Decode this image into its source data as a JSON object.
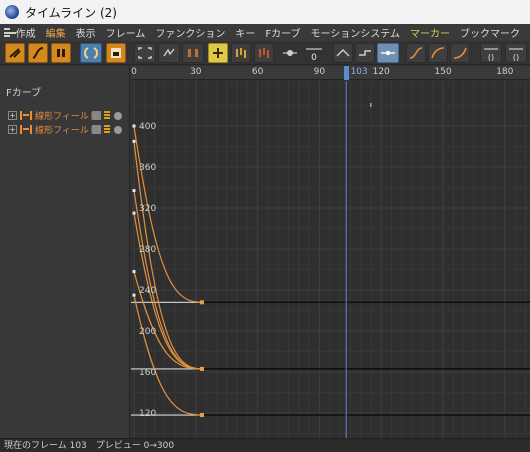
{
  "window": {
    "title": "タイムライン (2)"
  },
  "menu": {
    "items": [
      {
        "label": "作成"
      },
      {
        "label": "編集",
        "active": true
      },
      {
        "label": "表示"
      },
      {
        "label": "フレーム"
      },
      {
        "label": "ファンクション"
      },
      {
        "label": "キー"
      },
      {
        "label": "Fカーブ"
      },
      {
        "label": "モーションシステム"
      },
      {
        "label": "マーカー",
        "marker": true
      },
      {
        "label": "ブックマーク"
      }
    ]
  },
  "panel": {
    "fcurve_label": "Fカーブ",
    "tracks": [
      {
        "expand": "+",
        "label": "線形フィールド"
      },
      {
        "expand": "+",
        "label": "線形フィールド"
      }
    ]
  },
  "ruler": {
    "ticks": [
      "0",
      "30",
      "60",
      "90",
      "120",
      "150",
      "180"
    ],
    "current_frame": "103"
  },
  "chart_data": {
    "type": "line",
    "x_axis": {
      "ticks": [
        0,
        30,
        60,
        90,
        120,
        150,
        180
      ],
      "current_frame": 103
    },
    "y_axis": {
      "ticks": [
        400,
        360,
        320,
        280,
        240,
        200,
        160,
        120
      ]
    },
    "series": [
      {
        "values": [
          [
            0,
            400
          ],
          [
            33,
            228
          ]
        ]
      },
      {
        "values": [
          [
            0,
            385
          ],
          [
            33,
            163
          ]
        ]
      },
      {
        "values": [
          [
            0,
            337
          ],
          [
            33,
            163
          ]
        ]
      },
      {
        "values": [
          [
            0,
            315
          ],
          [
            33,
            163
          ]
        ]
      },
      {
        "values": [
          [
            0,
            258
          ],
          [
            33,
            163
          ]
        ]
      },
      {
        "values": [
          [
            0,
            235
          ],
          [
            33,
            118
          ]
        ]
      }
    ],
    "flat_lines": [
      228,
      163,
      118
    ],
    "colors": {
      "curve": "#e0913e",
      "key": "#e8a040",
      "current": "#5b89d4"
    }
  },
  "status": {
    "text": "現在のフレーム 103　プレビュー 0→300"
  }
}
